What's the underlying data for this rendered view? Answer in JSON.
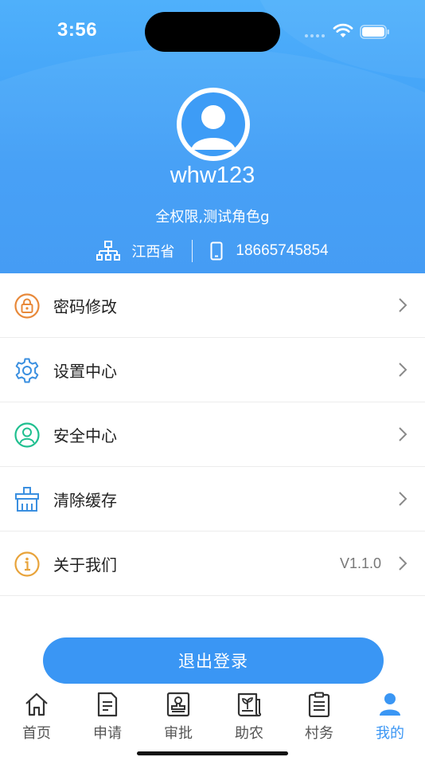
{
  "status_bar": {
    "time": "3:56"
  },
  "profile": {
    "username": "whw123",
    "role": "全权限,测试角色g",
    "org": "江西省",
    "phone": "18665745854"
  },
  "menu": [
    {
      "label": "密码修改",
      "icon": "lock-icon",
      "value": ""
    },
    {
      "label": "设置中心",
      "icon": "gear-icon",
      "value": ""
    },
    {
      "label": "安全中心",
      "icon": "user-shield-icon",
      "value": ""
    },
    {
      "label": "清除缓存",
      "icon": "broom-icon",
      "value": ""
    },
    {
      "label": "关于我们",
      "icon": "info-icon",
      "value": "V1.1.0"
    }
  ],
  "logout_label": "退出登录",
  "tabs": [
    {
      "label": "首页",
      "icon": "home-icon",
      "active": false
    },
    {
      "label": "申请",
      "icon": "document-icon",
      "active": false
    },
    {
      "label": "审批",
      "icon": "stamp-icon",
      "active": false
    },
    {
      "label": "助农",
      "icon": "newspaper-plant-icon",
      "active": false
    },
    {
      "label": "村务",
      "icon": "clipboard-list-icon",
      "active": false
    },
    {
      "label": "我的",
      "icon": "user-icon",
      "active": true
    }
  ],
  "colors": {
    "primary": "#3a96f4",
    "lock": "#e8893a",
    "gear": "#3a8fe0",
    "shield": "#1fbf8f",
    "broom": "#3a8fe0",
    "info": "#e8a33a"
  }
}
